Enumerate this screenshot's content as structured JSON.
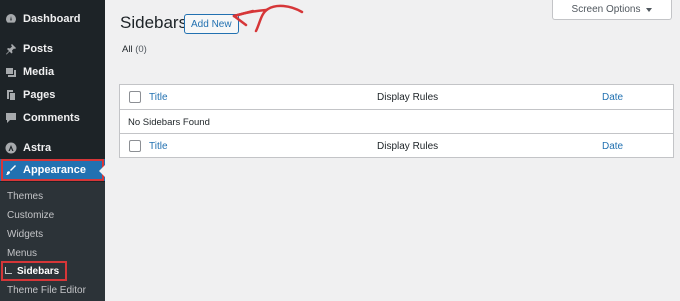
{
  "sidebar": {
    "items": [
      {
        "label": "Dashboard",
        "icon": "dashboard-icon"
      },
      {
        "label": "Posts",
        "icon": "pin-icon"
      },
      {
        "label": "Media",
        "icon": "media-icon"
      },
      {
        "label": "Pages",
        "icon": "pages-icon"
      },
      {
        "label": "Comments",
        "icon": "comments-icon"
      },
      {
        "label": "Astra",
        "icon": "astra-icon"
      },
      {
        "label": "Appearance",
        "icon": "paintbrush-icon",
        "active": true
      }
    ],
    "submenu": [
      "Themes",
      "Customize",
      "Widgets",
      "Menus",
      "Sidebars",
      "Theme File Editor"
    ],
    "current_sub": "Sidebars"
  },
  "header": {
    "title": "Sidebars",
    "add_new": "Add New",
    "screen_options": "Screen Options"
  },
  "filter": {
    "label": "All",
    "count": "(0)"
  },
  "table": {
    "columns": {
      "title": "Title",
      "rules": "Display Rules",
      "date": "Date"
    },
    "empty_message": "No Sidebars Found"
  },
  "colors": {
    "accent": "#2271b1",
    "highlight": "#d63638",
    "admin_bar": "#1d2327"
  }
}
